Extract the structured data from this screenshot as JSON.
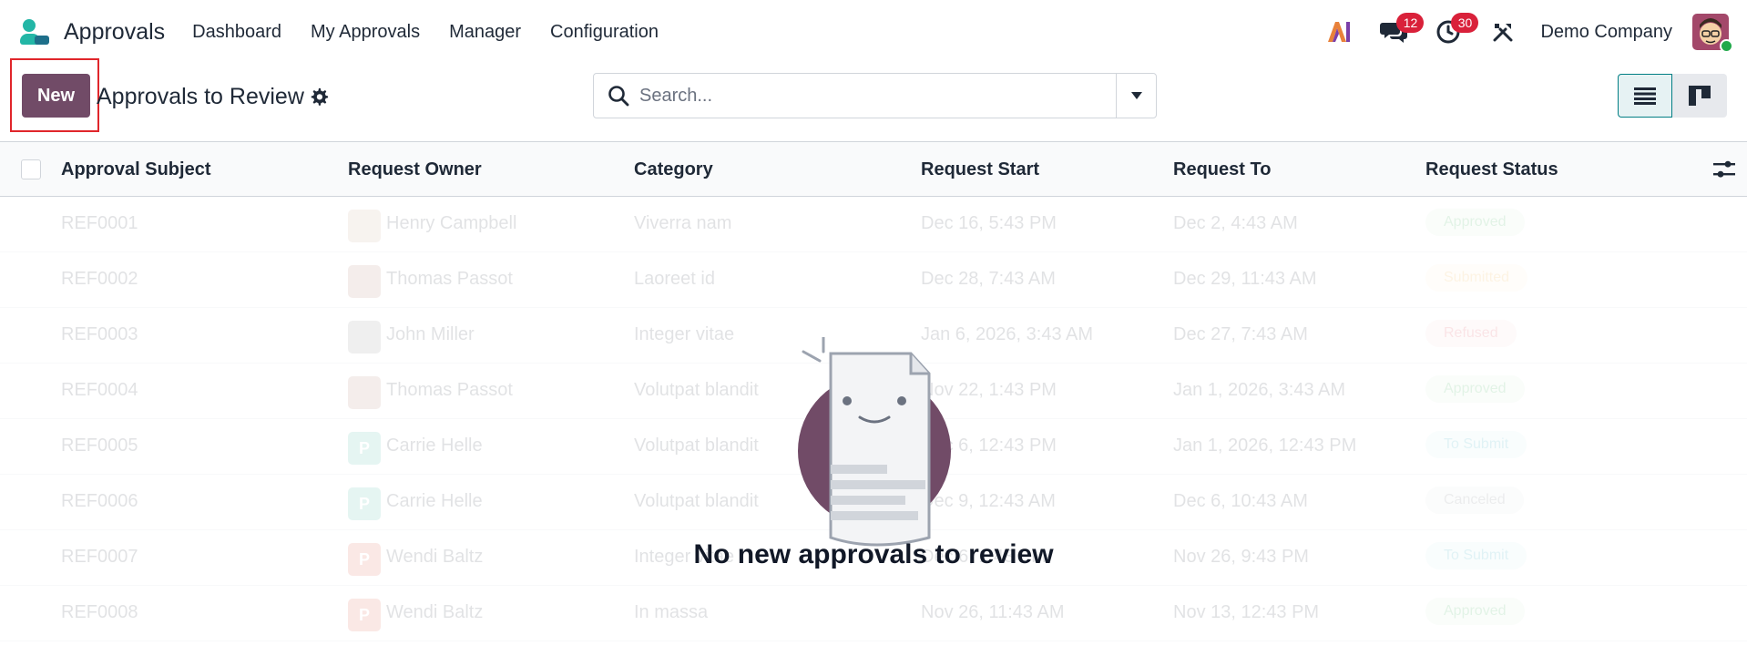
{
  "navbar": {
    "app_name": "Approvals",
    "menu": [
      {
        "label": "Dashboard"
      },
      {
        "label": "My Approvals"
      },
      {
        "label": "Manager"
      },
      {
        "label": "Configuration"
      }
    ],
    "messages_count": "12",
    "activities_count": "30",
    "company": "Demo Company",
    "icons": {
      "ai": "ai-icon",
      "messages": "chat-icon",
      "activities": "clock-icon",
      "debug": "tools-icon"
    }
  },
  "control_panel": {
    "new_label": "New",
    "view_title": "Approvals to Review",
    "search_placeholder": "Search...",
    "accent_color": "#714b67"
  },
  "table": {
    "columns": [
      {
        "label": "Approval Subject"
      },
      {
        "label": "Request Owner"
      },
      {
        "label": "Category"
      },
      {
        "label": "Request Start"
      },
      {
        "label": "Request To"
      },
      {
        "label": "Request Status"
      }
    ],
    "rows": [
      {
        "subject": "REF0001",
        "owner": "Henry Campbell",
        "owner_initial": "",
        "owner_color": "#c9a98a",
        "category": "Viverra nam",
        "start": "Dec 16, 5:43 PM",
        "to": "Dec 2, 4:43 AM",
        "status": "Approved",
        "status_color": "#28a745"
      },
      {
        "subject": "REF0002",
        "owner": "Thomas Passot",
        "owner_initial": "",
        "owner_color": "#b07a6a",
        "category": "Laoreet id",
        "start": "Dec 28, 7:43 AM",
        "to": "Dec 29, 11:43 AM",
        "status": "Submitted",
        "status_color": "#f0a92e"
      },
      {
        "subject": "REF0003",
        "owner": "John Miller",
        "owner_initial": "",
        "owner_color": "#8a8a8a",
        "category": "Integer vitae",
        "start": "Jan 6, 2026, 3:43 AM",
        "to": "Dec 27, 7:43 AM",
        "status": "Refused",
        "status_color": "#dc3545"
      },
      {
        "subject": "REF0004",
        "owner": "Thomas Passot",
        "owner_initial": "",
        "owner_color": "#b07a6a",
        "category": "Volutpat blandit",
        "start": "Nov 22, 1:43 PM",
        "to": "Jan 1, 2026, 3:43 AM",
        "status": "Approved",
        "status_color": "#28a745"
      },
      {
        "subject": "REF0005",
        "owner": "Carrie Helle",
        "owner_initial": "P",
        "owner_color": "#3fb8a0",
        "category": "Volutpat blandit",
        "start": "Dec 6, 12:43 PM",
        "to": "Jan 1, 2026, 12:43 PM",
        "status": "To Submit",
        "status_color": "#17a2b8"
      },
      {
        "subject": "REF0006",
        "owner": "Carrie Helle",
        "owner_initial": "P",
        "owner_color": "#3fb8a0",
        "category": "Volutpat blandit",
        "start": "Dec 9, 12:43 AM",
        "to": "Dec 6, 10:43 AM",
        "status": "Canceled",
        "status_color": "#6c757d"
      },
      {
        "subject": "REF0007",
        "owner": "Wendi Baltz",
        "owner_initial": "P",
        "owner_color": "#e0533f",
        "category": "Integer vitae",
        "start": "Dec 6, 1:43 PM",
        "to": "Nov 26, 9:43 PM",
        "status": "To Submit",
        "status_color": "#17a2b8"
      },
      {
        "subject": "REF0008",
        "owner": "Wendi Baltz",
        "owner_initial": "P",
        "owner_color": "#e0533f",
        "category": "In massa",
        "start": "Nov 26, 11:43 AM",
        "to": "Nov 13, 12:43 PM",
        "status": "Approved",
        "status_color": "#28a745"
      }
    ]
  },
  "empty_state": {
    "message": "No new approvals to review"
  }
}
